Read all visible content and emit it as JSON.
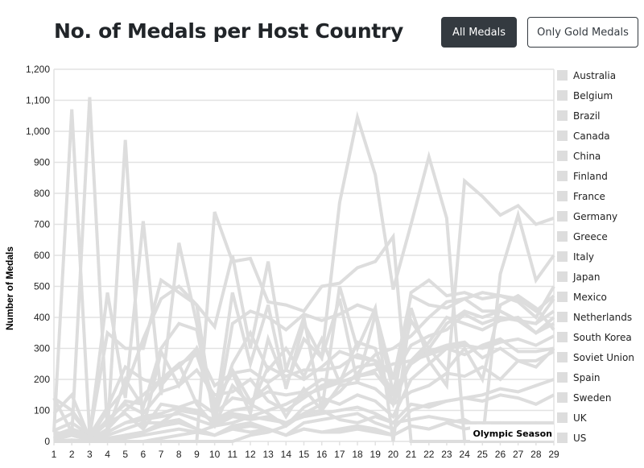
{
  "header": {
    "title": "No. of Medals per Host Country",
    "buttons": [
      {
        "label": "All Medals",
        "active": true
      },
      {
        "label": "Only Gold Medals",
        "active": false
      }
    ]
  },
  "colors": {
    "line": "#dddddd",
    "grid": "#e2e2e2",
    "legend_swatch": "#dddddd",
    "button_active_bg": "#343a40",
    "title": "#212529"
  },
  "chart_data": {
    "type": "line",
    "title": "No. of Medals per Host Country",
    "xlabel": "Olympic Season",
    "ylabel": "Number of Medals",
    "x": [
      1,
      2,
      3,
      4,
      5,
      6,
      7,
      8,
      9,
      10,
      11,
      12,
      13,
      14,
      15,
      16,
      17,
      18,
      19,
      20,
      21,
      22,
      23,
      24,
      25,
      26,
      27,
      28,
      29
    ],
    "ylim": [
      0,
      1200
    ],
    "yticks": [
      "0",
      "100",
      "200",
      "300",
      "400",
      "500",
      "600",
      "700",
      "800",
      "900",
      "1,000",
      "1,100",
      "1,200"
    ],
    "xticks": [
      "1",
      "2",
      "3",
      "4",
      "5",
      "6",
      "7",
      "8",
      "9",
      "10",
      "11",
      "12",
      "13",
      "14",
      "15",
      "16",
      "17",
      "18",
      "19",
      "20",
      "21",
      "22",
      "23",
      "24",
      "25",
      "26",
      "27",
      "28",
      "29"
    ],
    "grid": true,
    "legend_position": "right",
    "series": [
      {
        "name": "Australia",
        "values": [
          35,
          60,
          20,
          30,
          200,
          110,
          300,
          380,
          360,
          80,
          250,
          350,
          230,
          300,
          210,
          330,
          190,
          320,
          300,
          120,
          480,
          520,
          470,
          480,
          460,
          470,
          450,
          400,
          500
        ]
      },
      {
        "name": "Belgium",
        "values": [
          5,
          20,
          5,
          40,
          100,
          150,
          200,
          250,
          120,
          50,
          180,
          120,
          90,
          50,
          110,
          140,
          120,
          150,
          130,
          80,
          200,
          250,
          300,
          280,
          310,
          330,
          290,
          290,
          300
        ]
      },
      {
        "name": "Brazil",
        "values": [
          0,
          5,
          0,
          10,
          20,
          30,
          50,
          60,
          40,
          20,
          50,
          60,
          40,
          20,
          60,
          70,
          80,
          90,
          60,
          40,
          100,
          120,
          130,
          140,
          150,
          170,
          160,
          180,
          200
        ]
      },
      {
        "name": "Canada",
        "values": [
          20,
          30,
          10,
          60,
          90,
          40,
          120,
          110,
          130,
          90,
          140,
          130,
          160,
          150,
          160,
          200,
          190,
          210,
          220,
          150,
          260,
          300,
          380,
          420,
          400,
          420,
          390,
          380,
          460
        ]
      },
      {
        "name": "China",
        "values": [
          0,
          0,
          0,
          0,
          0,
          0,
          0,
          0,
          0,
          0,
          0,
          20,
          30,
          50,
          90,
          120,
          160,
          220,
          280,
          300,
          340,
          400,
          450,
          460,
          480,
          470,
          460,
          420,
          470
        ]
      },
      {
        "name": "Finland",
        "values": [
          10,
          40,
          20,
          30,
          60,
          80,
          90,
          110,
          100,
          60,
          90,
          80,
          70,
          60,
          90,
          100,
          70,
          60,
          80,
          60,
          70,
          80,
          70,
          60,
          60,
          60,
          60,
          60,
          60
        ]
      },
      {
        "name": "France",
        "values": [
          140,
          100,
          20,
          110,
          240,
          200,
          180,
          250,
          280,
          110,
          230,
          130,
          180,
          80,
          170,
          100,
          180,
          190,
          170,
          120,
          160,
          180,
          220,
          210,
          240,
          200,
          260,
          260,
          290
        ]
      },
      {
        "name": "Germany",
        "values": [
          90,
          150,
          10,
          100,
          170,
          330,
          460,
          500,
          440,
          50,
          380,
          420,
          400,
          360,
          410,
          390,
          410,
          440,
          420,
          200,
          470,
          440,
          430,
          460,
          420,
          420,
          390,
          350,
          400
        ]
      },
      {
        "name": "Greece",
        "values": [
          140,
          30,
          0,
          20,
          40,
          60,
          60,
          70,
          40,
          20,
          40,
          50,
          40,
          20,
          40,
          30,
          40,
          50,
          40,
          20,
          50,
          40,
          60,
          70,
          40,
          60,
          50,
          40,
          50
        ]
      },
      {
        "name": "Italy",
        "values": [
          20,
          40,
          10,
          60,
          130,
          120,
          200,
          240,
          300,
          130,
          220,
          230,
          190,
          230,
          200,
          240,
          290,
          270,
          260,
          120,
          260,
          320,
          400,
          380,
          360,
          390,
          400,
          350,
          380
        ]
      },
      {
        "name": "Japan",
        "values": [
          0,
          0,
          0,
          0,
          20,
          30,
          60,
          100,
          90,
          70,
          100,
          110,
          240,
          210,
          230,
          230,
          240,
          280,
          260,
          210,
          310,
          340,
          360,
          410,
          380,
          400,
          390,
          380,
          420
        ]
      },
      {
        "name": "Mexico",
        "values": [
          0,
          0,
          0,
          0,
          10,
          20,
          30,
          40,
          30,
          20,
          40,
          30,
          40,
          20,
          40,
          30,
          30,
          40,
          30,
          20,
          50,
          40,
          60,
          40,
          50,
          40,
          50,
          60,
          50
        ]
      },
      {
        "name": "Netherlands",
        "values": [
          10,
          40,
          10,
          70,
          120,
          90,
          160,
          180,
          230,
          150,
          160,
          200,
          130,
          100,
          140,
          180,
          200,
          240,
          250,
          160,
          250,
          290,
          310,
          320,
          270,
          300,
          260,
          240,
          300
        ]
      },
      {
        "name": "South Korea",
        "values": [
          0,
          0,
          0,
          0,
          0,
          0,
          10,
          20,
          30,
          50,
          60,
          80,
          100,
          120,
          150,
          170,
          190,
          210,
          230,
          250,
          260,
          280,
          300,
          310,
          300,
          320,
          330,
          310,
          340
        ]
      },
      {
        "name": "Soviet Union",
        "values": [
          0,
          0,
          0,
          0,
          0,
          0,
          0,
          0,
          0,
          740,
          580,
          590,
          450,
          440,
          420,
          500,
          510,
          560,
          580,
          660,
          0,
          0,
          0,
          0,
          0,
          0,
          0,
          0,
          0
        ]
      },
      {
        "name": "Spain",
        "values": [
          10,
          20,
          5,
          30,
          60,
          70,
          80,
          90,
          70,
          50,
          80,
          70,
          80,
          60,
          80,
          90,
          100,
          110,
          90,
          60,
          120,
          110,
          130,
          140,
          130,
          150,
          140,
          120,
          150
        ]
      },
      {
        "name": "Sweden",
        "values": [
          60,
          90,
          20,
          480,
          140,
          710,
          150,
          640,
          380,
          80,
          480,
          250,
          440,
          170,
          380,
          270,
          460,
          190,
          410,
          160,
          390,
          300,
          230,
          300,
          200,
          440,
          470,
          430,
          360
        ]
      },
      {
        "name": "UK",
        "values": [
          30,
          1071,
          20,
          350,
          300,
          300,
          520,
          480,
          440,
          370,
          600,
          300,
          580,
          230,
          400,
          100,
          500,
          300,
          430,
          0,
          430,
          260,
          180,
          840,
          790,
          730,
          760,
          700,
          720
        ]
      },
      {
        "name": "US",
        "values": [
          30,
          20,
          1110,
          30,
          972,
          40,
          290,
          180,
          300,
          180,
          220,
          90,
          330,
          180,
          330,
          270,
          770,
          1045,
          860,
          490,
          700,
          918,
          720,
          0,
          0,
          540,
          730,
          520,
          600
        ]
      }
    ]
  }
}
